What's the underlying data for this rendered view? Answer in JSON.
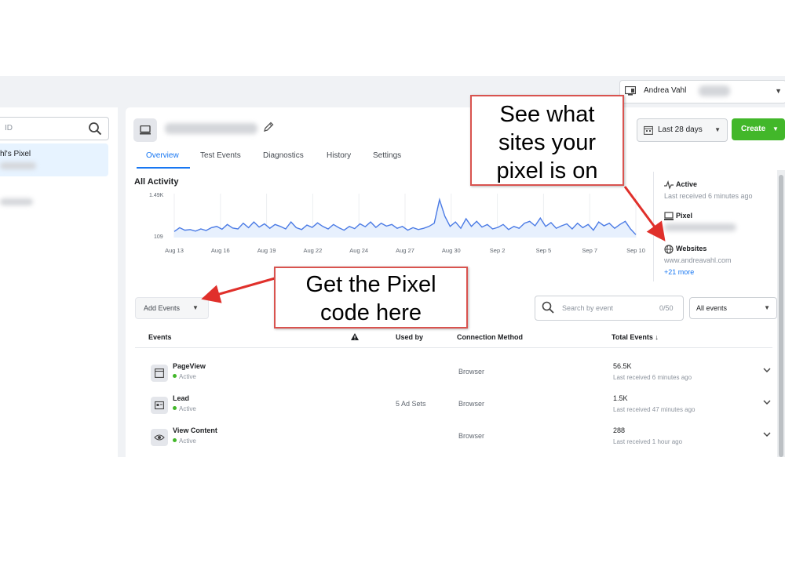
{
  "account": {
    "name": "Andrea Vahl"
  },
  "left": {
    "search_placeholder": "ID",
    "selected_pixel": "hl's Pixel"
  },
  "tabs": [
    "Overview",
    "Test Events",
    "Diagnostics",
    "History",
    "Settings"
  ],
  "toolbar": {
    "date_range": "Last 28 days",
    "create": "Create"
  },
  "activity": {
    "title": "All Activity",
    "y_top": "1.49K",
    "y_bottom": "109",
    "x_ticks": [
      "Aug 13",
      "Aug 16",
      "Aug 19",
      "Aug 22",
      "Aug 24",
      "Aug 27",
      "Aug 30",
      "Sep 2",
      "Sep 5",
      "Sep 7",
      "Sep 10"
    ]
  },
  "status_panel": {
    "active_label": "Active",
    "active_sub": "Last received 6 minutes ago",
    "pixel_label": "Pixel",
    "websites_label": "Websites",
    "website": "www.andreavahl.com",
    "more": "+21 more"
  },
  "events": {
    "add_events": "Add Events",
    "search_placeholder": "Search by event",
    "search_count": "0/50",
    "filter": "All events",
    "headers": {
      "events": "Events",
      "used_by": "Used by",
      "connection": "Connection Method",
      "total": "Total Events ↓"
    },
    "rows": [
      {
        "name": "PageView",
        "status": "Active",
        "used_by": "",
        "connection": "Browser",
        "total": "56.5K",
        "last": "Last received 6 minutes ago"
      },
      {
        "name": "Lead",
        "status": "Active",
        "used_by": "5 Ad Sets",
        "connection": "Browser",
        "total": "1.5K",
        "last": "Last received 47 minutes ago"
      },
      {
        "name": "View Content",
        "status": "Active",
        "used_by": "",
        "connection": "Browser",
        "total": "288",
        "last": "Last received 1 hour ago"
      }
    ]
  },
  "callouts": {
    "sites": [
      "See what",
      "sites your",
      "pixel is on"
    ],
    "code": [
      "Get the Pixel",
      "code here"
    ]
  },
  "colors": {
    "accent": "#1877f2",
    "create": "#42b72a",
    "callout_border": "#d9534f",
    "arrow": "#e0302b"
  },
  "chart_data": {
    "type": "line",
    "categories": [
      "Aug 13",
      "Aug 16",
      "Aug 19",
      "Aug 22",
      "Aug 24",
      "Aug 27",
      "Aug 30",
      "Sep 2",
      "Sep 5",
      "Sep 7",
      "Sep 10"
    ],
    "ylim": [
      109,
      1490
    ],
    "values": [
      300,
      420,
      340,
      360,
      310,
      380,
      330,
      420,
      460,
      370,
      520,
      410,
      380,
      560,
      420,
      600,
      440,
      540,
      400,
      520,
      460,
      380,
      600,
      420,
      360,
      500,
      430,
      570,
      460,
      380,
      520,
      420,
      340,
      460,
      390,
      540,
      450,
      600,
      430,
      560,
      470,
      520,
      400,
      460,
      340,
      420,
      360,
      400,
      460,
      560,
      1300,
      780,
      460,
      600,
      400,
      700,
      460,
      620,
      440,
      520,
      380,
      430,
      520,
      360,
      460,
      400,
      560,
      620,
      480,
      720,
      460,
      580,
      400,
      480,
      540,
      380,
      560,
      420,
      520,
      340,
      600,
      480,
      560,
      400,
      520,
      620,
      380,
      200
    ]
  }
}
